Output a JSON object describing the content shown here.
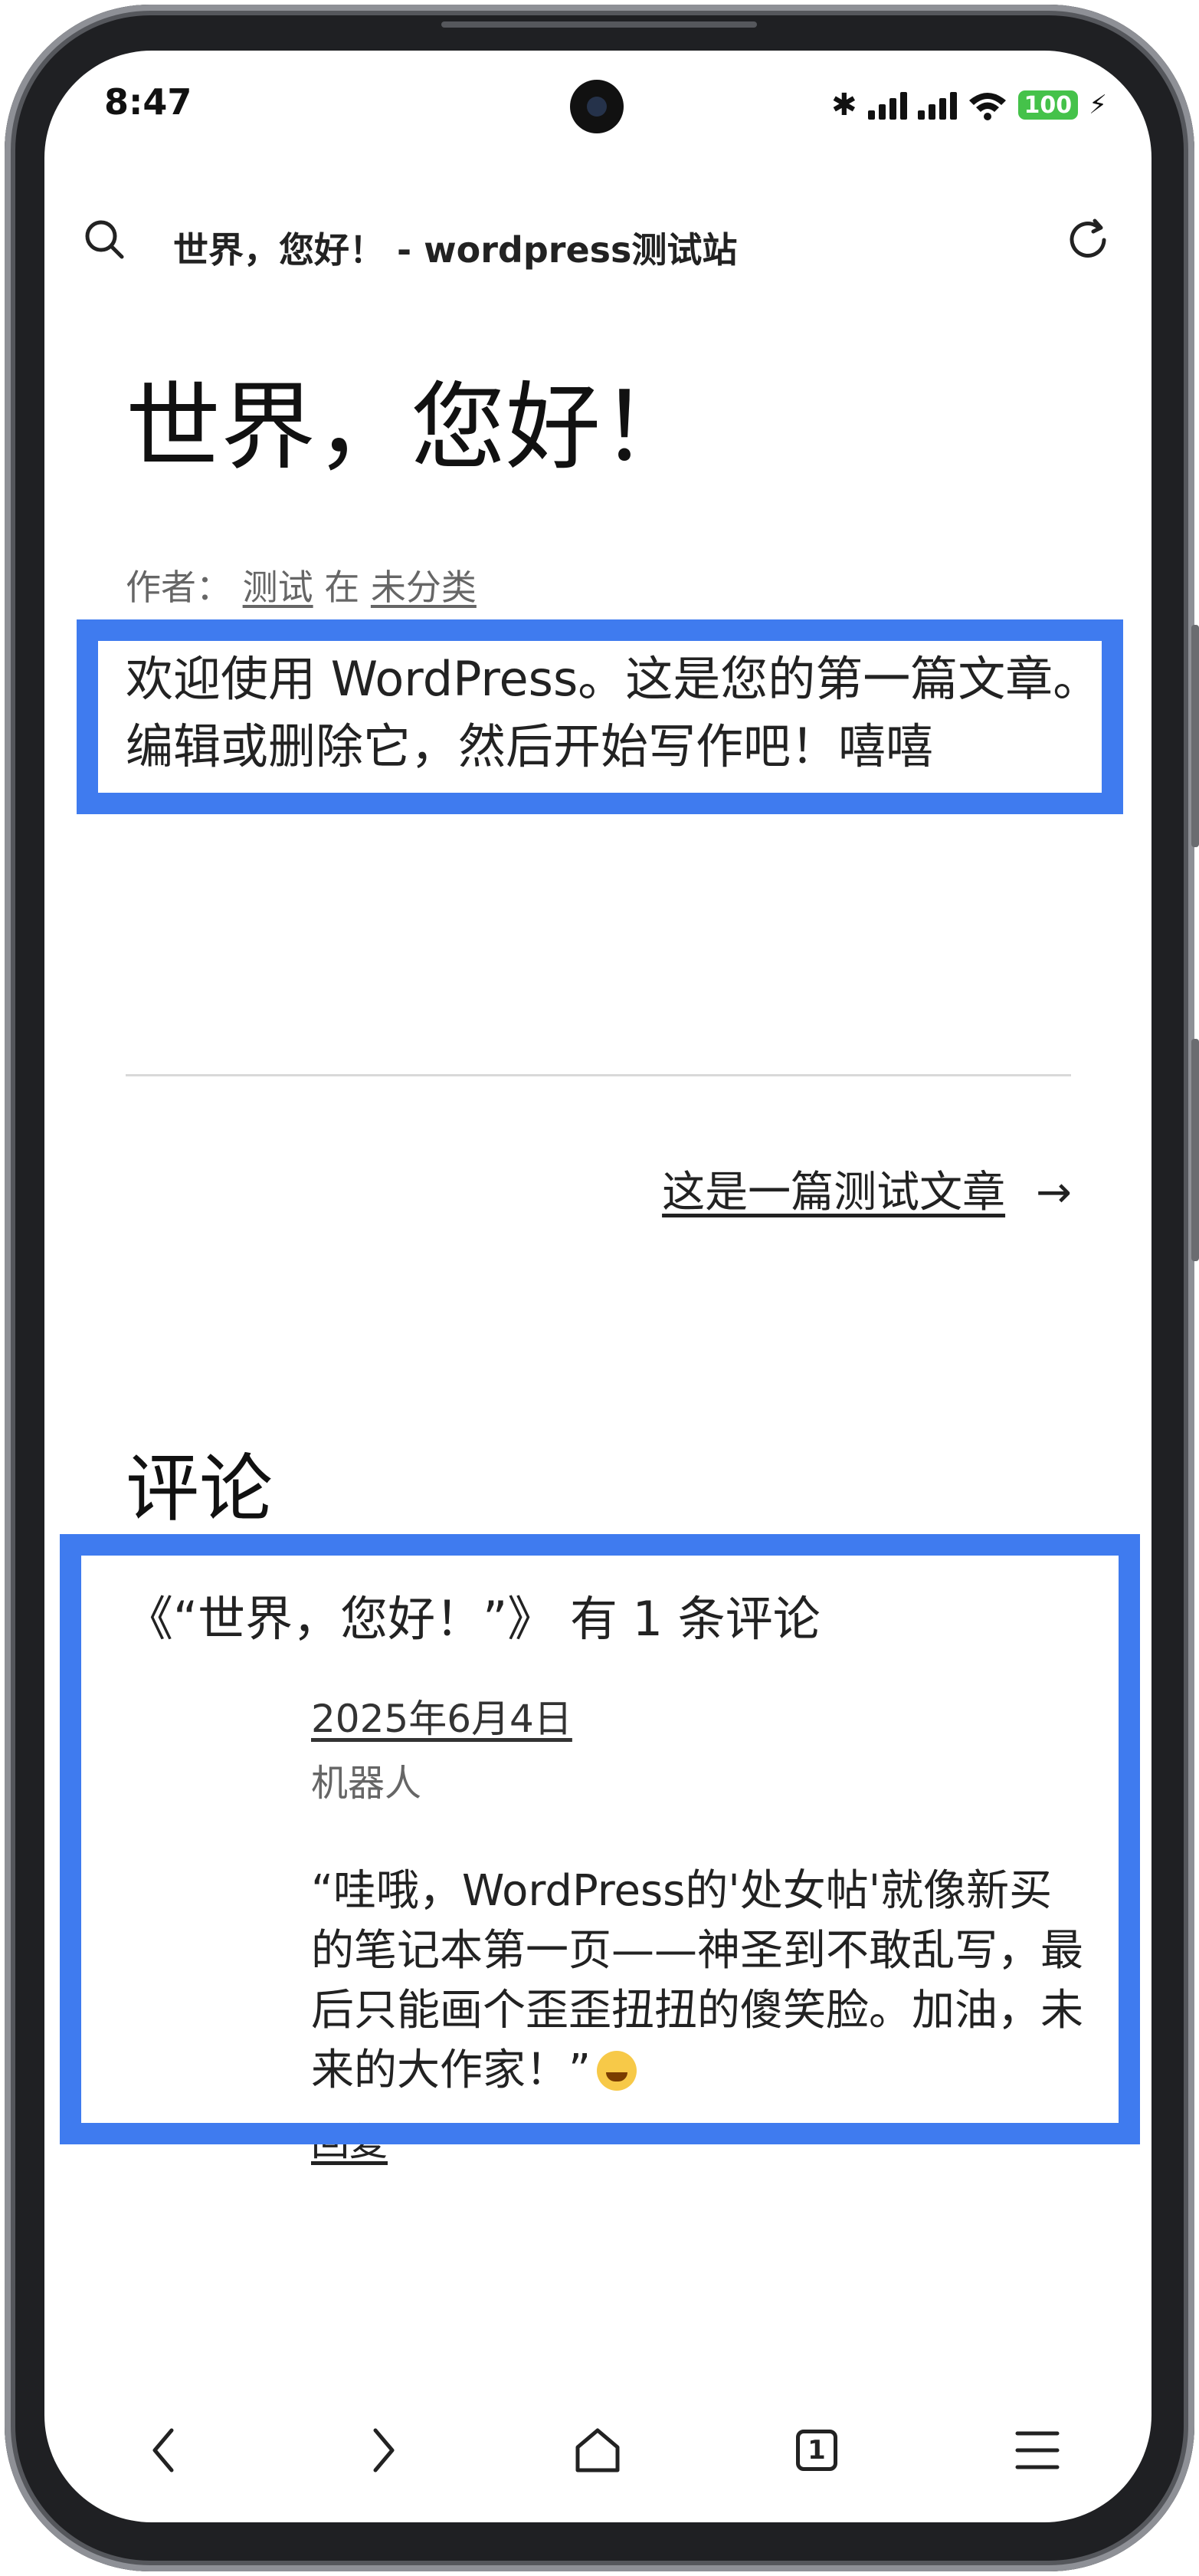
{
  "status_bar": {
    "time": "8:47",
    "battery": "100",
    "icons": [
      "bluetooth-icon",
      "signal-icon",
      "signal-icon",
      "wifi-icon",
      "battery-icon",
      "charging-icon"
    ]
  },
  "toolbar": {
    "page_title": "世界，您好！ - wordpress测试站",
    "search_icon": "search-icon",
    "reload_icon": "reload-icon"
  },
  "post": {
    "title": "世界，您好！",
    "meta_prefix": "作者：",
    "author": "测试",
    "meta_in": "在",
    "category": "未分类",
    "body": "欢迎使用 WordPress。这是您的第一篇文章。编辑或删除它，然后开始写作吧！嘻嘻"
  },
  "navigation": {
    "next_post": "这是一篇测试文章",
    "next_arrow": "→"
  },
  "comments": {
    "heading": "评论",
    "count_text": "《“世界，您好！”》 有 1 条评论",
    "items": [
      {
        "date": "2025年6月4日",
        "author": "机器人",
        "text": "“哇哦，WordPress的'处女帖'就像新买的笔记本第一页——神圣到不敢乱写，最后只能画个歪歪扭扭的傻笑脸。加油，未来的大作家！”",
        "reply": "回复"
      }
    ]
  },
  "bottom_nav": {
    "tab_count": "1",
    "icons": [
      "back-icon",
      "forward-icon",
      "home-icon",
      "tabs-icon",
      "menu-icon"
    ]
  },
  "colors": {
    "highlight": "#3f7bef",
    "battery": "#45c24a"
  }
}
